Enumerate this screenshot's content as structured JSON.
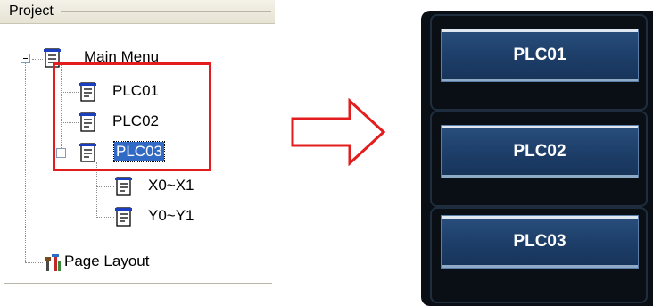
{
  "project": {
    "title": "Project",
    "tree": {
      "root": "Main Menu",
      "children": [
        "PLC01",
        "PLC02",
        "PLC03"
      ],
      "plc03_children": [
        "X0~X1",
        "Y0~Y1"
      ],
      "page_layout": "Page Layout",
      "selected": "PLC03"
    }
  },
  "hmi": {
    "buttons": [
      "PLC01",
      "PLC02",
      "PLC03"
    ]
  },
  "colors": {
    "highlight": "#e31d1d",
    "selection": "#316ac5",
    "hmi_background": "#0a0f16",
    "hmi_button": "#1e406b"
  }
}
